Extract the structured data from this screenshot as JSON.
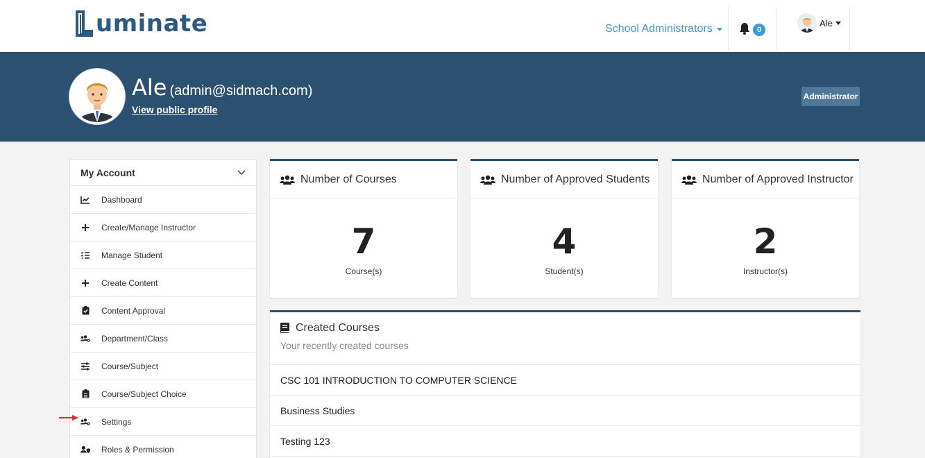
{
  "brand": {
    "logo_text": "uminate"
  },
  "nav": {
    "role_label": "School Administrators",
    "notification_count": "0",
    "user_name": "Ale"
  },
  "profile": {
    "name": "Ale",
    "email": "(admin@sidmach.com)",
    "public_profile_link": "View public profile",
    "role_badge": "Administrator"
  },
  "sidebar": {
    "header": "My Account",
    "items": [
      {
        "label": "Dashboard",
        "icon": "chart-line-icon"
      },
      {
        "label": "Create/Manage Instructor",
        "icon": "plus-icon"
      },
      {
        "label": "Manage Student",
        "icon": "list-check-icon"
      },
      {
        "label": "Create Content",
        "icon": "plus-icon"
      },
      {
        "label": "Content Approval",
        "icon": "clipboard-check-icon"
      },
      {
        "label": "Department/Class",
        "icon": "users-cog-icon"
      },
      {
        "label": "Course/Subject",
        "icon": "sliders-icon"
      },
      {
        "label": "Course/Subject Choice",
        "icon": "clipboard-list-icon"
      },
      {
        "label": "Settings",
        "icon": "users-cog-icon"
      },
      {
        "label": "Roles & Permission",
        "icon": "user-shield-icon"
      }
    ]
  },
  "stats": [
    {
      "title": "Number of Courses",
      "value": "7",
      "unit": "Course(s)"
    },
    {
      "title": "Number of Approved Students",
      "value": "4",
      "unit": "Student(s)"
    },
    {
      "title": "Number of Approved Instructor",
      "value": "2",
      "unit": "Instructor(s)"
    }
  ],
  "created_courses": {
    "title": "Created Courses",
    "subtitle": "Your recently created courses",
    "items": [
      "CSC 101 INTRODUCTION TO COMPUTER SCIENCE",
      "Business Studies",
      "Testing 123"
    ]
  },
  "colors": {
    "banner": "#2b5070",
    "accent": "#3a9ad9",
    "logo": "#2c5a82"
  }
}
